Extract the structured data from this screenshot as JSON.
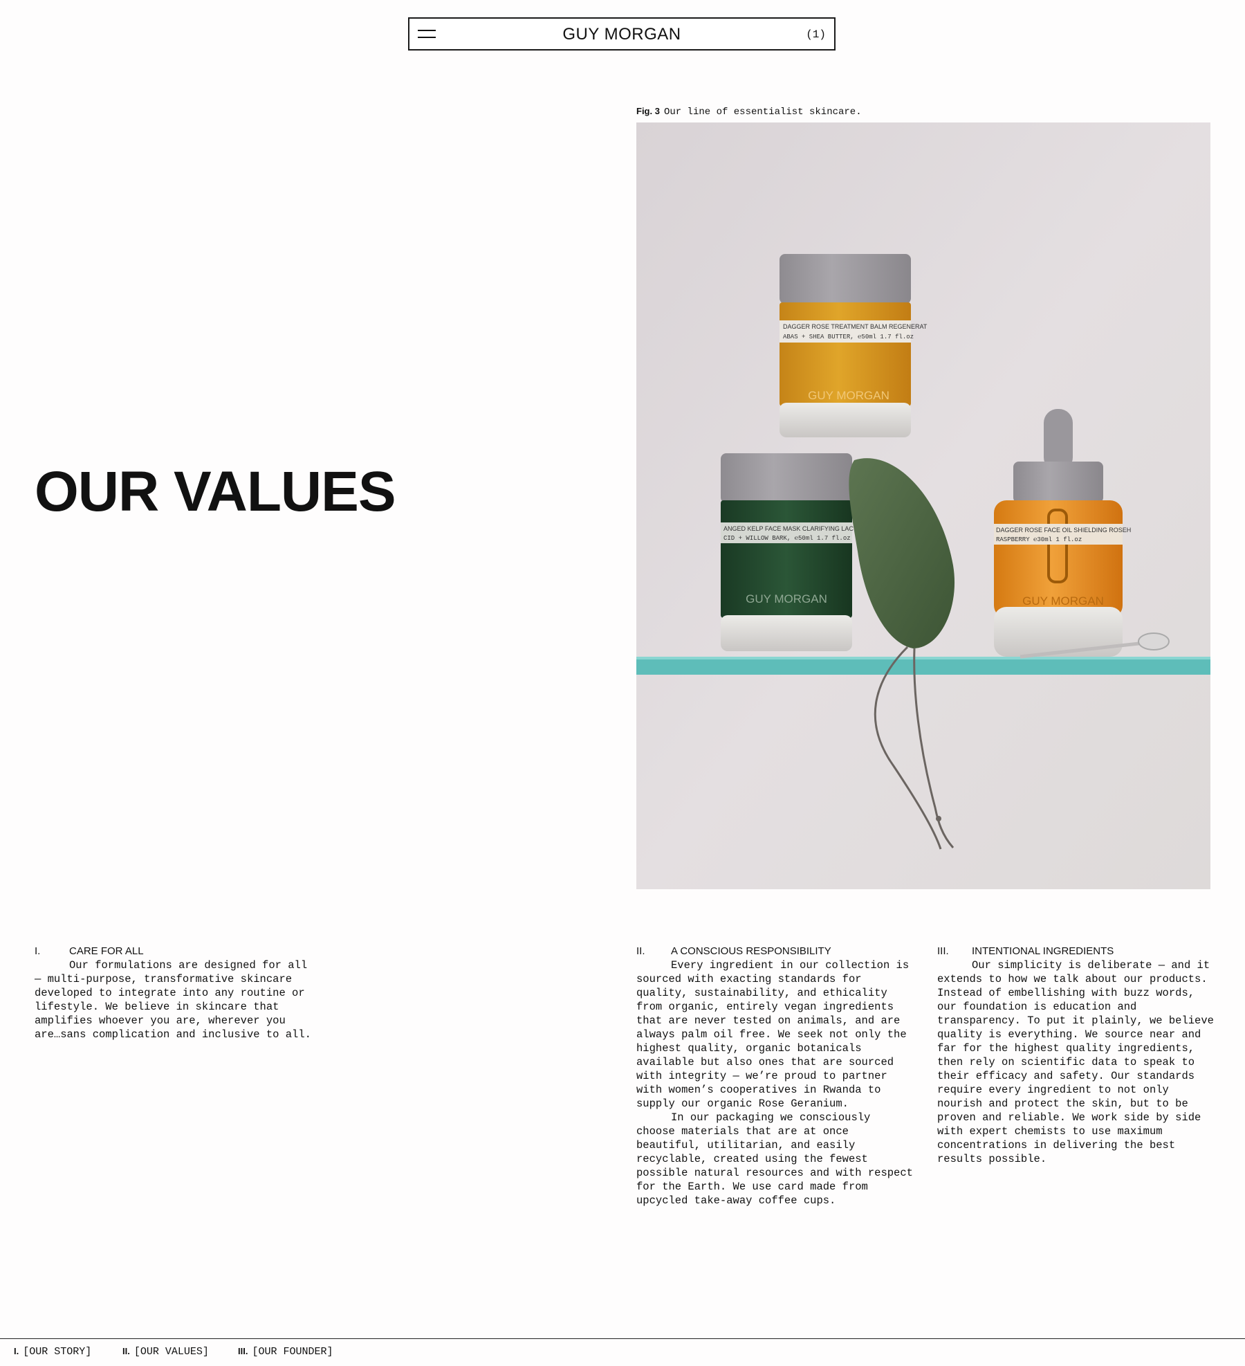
{
  "header": {
    "brand": "GUY MORGAN",
    "cart_count": "(1)",
    "menu_icon": "hamburger-menu-icon"
  },
  "page": {
    "title": "OUR VALUES"
  },
  "figure": {
    "label": "Fig. 3",
    "caption": "Our line of essentialist skincare.",
    "products": [
      {
        "brand": "GUY MORGAN",
        "label_line1": "DAGGER ROSE TREATMENT BALM  REGENERAT",
        "label_line2": "ABAS + SHEA BUTTER, ℮50ml 1.7 fl.oz"
      },
      {
        "brand": "GUY MORGAN",
        "label_line1": "ANGED KELP FACE MASK  CLARIFYING LACT",
        "label_line2": "CID + WILLOW BARK, ℮50ml 1.7 fl.oz"
      },
      {
        "brand": "GUY MORGAN",
        "label_line1": "DAGGER ROSE FACE OIL  SHIELDING ROSEH",
        "label_line2": "RASPBERRY  ℮30ml 1 fl.oz"
      }
    ]
  },
  "sections": [
    {
      "num": "I.",
      "title": "CARE FOR ALL",
      "paragraphs": [
        "Our formulations are designed for all — multi-purpose, transformative skincare developed to integrate into any routine or lifestyle. We believe in skincare that amplifies whoever you are, wherever you are…sans complication and inclusive to all."
      ]
    },
    {
      "num": "II.",
      "title": "A CONSCIOUS RESPONSIBILITY",
      "paragraphs": [
        "Every ingredient in our collection is sourced with exacting standards for quality, sustainability, and ethicality from organic, entirely vegan ingredients that are never tested on animals, and are always palm oil free. We seek not only the highest quality, organic botanicals available but also ones that are sourced with integrity — we’re proud to partner with women’s cooperatives in Rwanda to supply our organic Rose Geranium.",
        "In our packaging we consciously choose materials that are at once beautiful, utilitarian, and easily recyclable, created using the fewest possible natural resources and with respect for the Earth. We use card made from upcycled take-away coffee cups."
      ]
    },
    {
      "num": "III.",
      "title": "INTENTIONAL INGREDIENTS",
      "paragraphs": [
        "Our simplicity is deliberate — and it extends to how we talk about our products. Instead of embellishing with buzz words, our foundation is education and transparency. To put it plainly, we believe quality is everything. We source near and far for the highest quality ingredients, then rely on scientific data to speak to their efficacy and safety. Our standards require every ingredient to not only nourish and protect the skin, but to be proven and reliable. We work side by side with expert chemists to use maximum concentrations in delivering the best results possible."
      ]
    }
  ],
  "bottom_nav": [
    {
      "num": "I.",
      "label": "[OUR STORY]"
    },
    {
      "num": "II.",
      "label": "[OUR VALUES]"
    },
    {
      "num": "III.",
      "label": "[OUR FOUNDER]"
    }
  ],
  "colors": {
    "background": "#fefdfd",
    "text": "#111111",
    "shelf": "#5ebdb9",
    "balm_jar": "#d99a22",
    "mask_jar": "#23482f",
    "oil_bottle": "#e0891f",
    "cap": "#9c999f"
  }
}
